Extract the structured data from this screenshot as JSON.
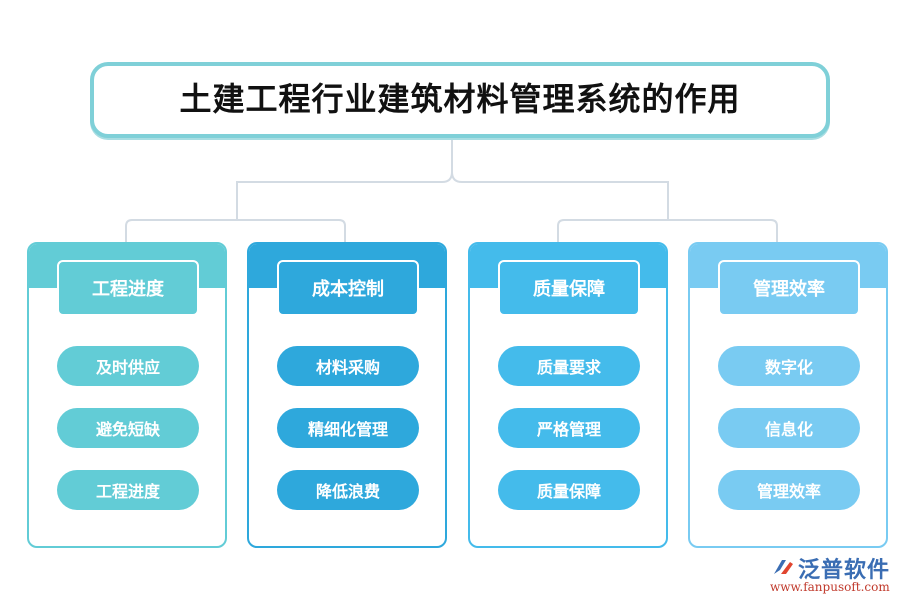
{
  "title": "土建工程行业建筑材料管理系统的作用",
  "colors": {
    "title_border": "#7fd0d8",
    "connector": "#d3dbe3",
    "text": "#111111"
  },
  "categories": [
    {
      "label": "工程进度",
      "color": "#62ccd6",
      "items": [
        "及时供应",
        "避免短缺",
        "工程进度"
      ]
    },
    {
      "label": "成本控制",
      "color": "#2ea8dc",
      "items": [
        "材料采购",
        "精细化管理",
        "降低浪费"
      ]
    },
    {
      "label": "质量保障",
      "color": "#44bbeb",
      "items": [
        "质量要求",
        "严格管理",
        "质量保障"
      ]
    },
    {
      "label": "管理效率",
      "color": "#79cbf2",
      "items": [
        "数字化",
        "信息化",
        "管理效率"
      ]
    }
  ],
  "watermark": {
    "brand": "泛普软件",
    "url": "www.fanpusoft.com"
  }
}
